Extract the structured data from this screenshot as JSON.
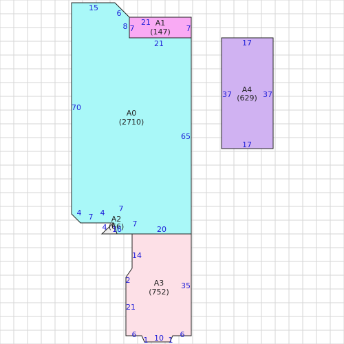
{
  "colors": {
    "grid": "#d6d6d6",
    "dimension_text": "#1c1cd8",
    "outline": "#222222",
    "A0": "#a9f8f8",
    "A1": "#f9aaf4",
    "A2": "#efefef",
    "A3": "#fde0e7",
    "A4": "#d0b2f2"
  },
  "areas": [
    {
      "id": "A0",
      "name": "A0",
      "area": "(2710)"
    },
    {
      "id": "A1",
      "name": "A1",
      "area": "(147)"
    },
    {
      "id": "A2",
      "name": "A2",
      "area": "(66)"
    },
    {
      "id": "A3",
      "name": "A3",
      "area": "(752)"
    },
    {
      "id": "A4",
      "name": "A4",
      "area": "(629)"
    }
  ],
  "dimensions": {
    "a0_top": "15",
    "a0_notch_left": "6",
    "a0_notch_vertical": "8",
    "a0_left": "70",
    "a0_right": "65",
    "a0_bottom_left_chamfer": "4",
    "a0_bottom_step": "7",
    "a0_bottom_chamfer2": "4",
    "a0_bottom_right": "20",
    "a1_top": "21",
    "a1_left": "7",
    "a1_right": "7",
    "a1_bottom": "21",
    "a2_top": "7",
    "a2_left": "4",
    "a2_right": "7",
    "a2_bottom": "16",
    "a3_left_upper": "14",
    "a3_left_step": "2",
    "a3_left_lower": "21",
    "a3_right": "35",
    "a3_bottom_left": "6",
    "a3_bottom_chamfer_left": "1",
    "a3_bottom_mid": "10",
    "a3_bottom_chamfer_right": "1",
    "a3_bottom_right": "6",
    "a4_top": "17",
    "a4_left": "37",
    "a4_right": "37",
    "a4_bottom": "17"
  }
}
